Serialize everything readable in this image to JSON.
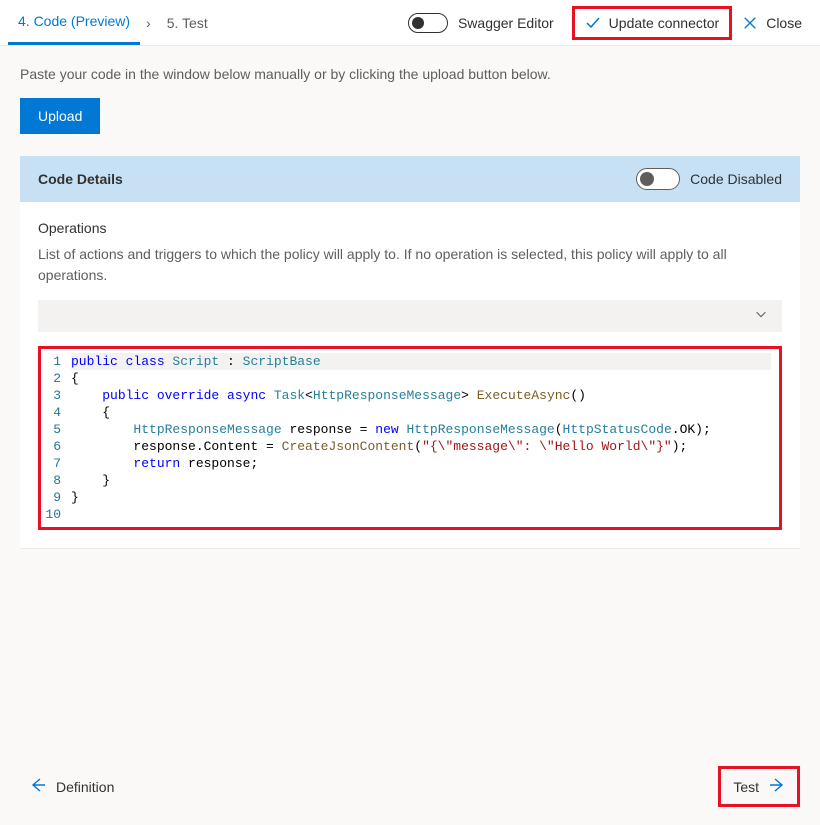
{
  "topbar": {
    "tab_active": "4. Code (Preview)",
    "tab_next": "5. Test",
    "swagger_label": "Swagger Editor",
    "update_label": "Update connector",
    "close_label": "Close"
  },
  "intro_text": "Paste your code in the window below manually or by clicking the upload button below.",
  "upload_label": "Upload",
  "details": {
    "title": "Code Details",
    "disabled_label": "Code Disabled"
  },
  "operations": {
    "title": "Operations",
    "desc": "List of actions and triggers to which the policy will apply to. If no operation is selected, this policy will apply to all operations."
  },
  "code": {
    "lines": [
      {
        "n": "1",
        "tokens": [
          {
            "t": "public class ",
            "c": "kw"
          },
          {
            "t": "Script",
            "c": "cls"
          },
          {
            "t": " : "
          },
          {
            "t": "ScriptBase",
            "c": "cls"
          }
        ],
        "active": true
      },
      {
        "n": "2",
        "tokens": [
          {
            "t": "{"
          }
        ]
      },
      {
        "n": "3",
        "tokens": [
          {
            "t": "    "
          },
          {
            "t": "public override async ",
            "c": "kw"
          },
          {
            "t": "Task",
            "c": "cls"
          },
          {
            "t": "<"
          },
          {
            "t": "HttpResponseMessage",
            "c": "cls"
          },
          {
            "t": "> "
          },
          {
            "t": "ExecuteAsync",
            "c": "mth"
          },
          {
            "t": "()"
          }
        ]
      },
      {
        "n": "4",
        "tokens": [
          {
            "t": "    {"
          }
        ]
      },
      {
        "n": "5",
        "tokens": [
          {
            "t": "        "
          },
          {
            "t": "HttpResponseMessage",
            "c": "cls"
          },
          {
            "t": " response = "
          },
          {
            "t": "new ",
            "c": "kw"
          },
          {
            "t": "HttpResponseMessage",
            "c": "cls"
          },
          {
            "t": "("
          },
          {
            "t": "HttpStatusCode",
            "c": "cls"
          },
          {
            "t": ".OK);"
          }
        ]
      },
      {
        "n": "6",
        "tokens": [
          {
            "t": "        response.Content = "
          },
          {
            "t": "CreateJsonContent",
            "c": "mth"
          },
          {
            "t": "("
          },
          {
            "t": "\"{\\\"message\\\": \\\"Hello World\\\"}\"",
            "c": "str"
          },
          {
            "t": ");"
          }
        ]
      },
      {
        "n": "7",
        "tokens": [
          {
            "t": "        "
          },
          {
            "t": "return ",
            "c": "kw"
          },
          {
            "t": "response;"
          }
        ]
      },
      {
        "n": "8",
        "tokens": [
          {
            "t": "    }"
          }
        ]
      },
      {
        "n": "9",
        "tokens": [
          {
            "t": "}"
          }
        ]
      },
      {
        "n": "10",
        "tokens": [
          {
            "t": ""
          }
        ]
      }
    ]
  },
  "footer": {
    "prev": "Definition",
    "next": "Test"
  }
}
